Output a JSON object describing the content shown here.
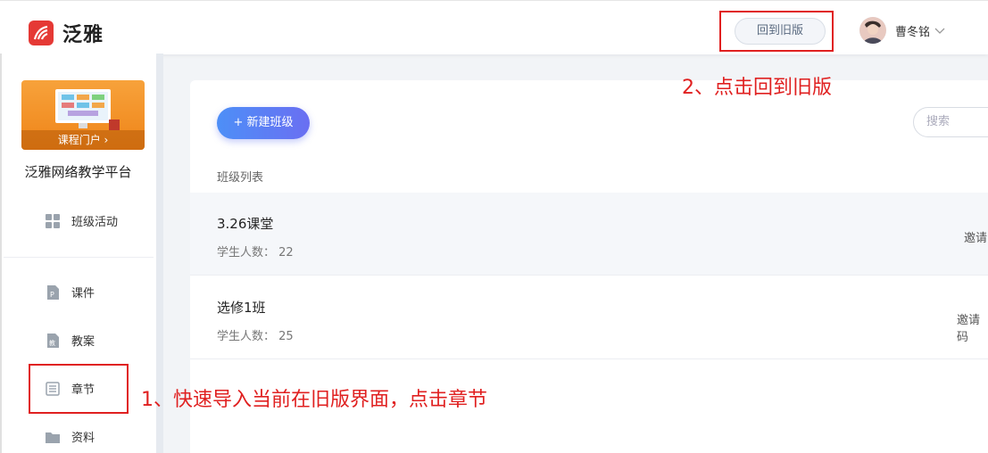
{
  "header": {
    "app_name": "泛雅",
    "old_version_button": "回到旧版",
    "user_name": "曹冬铭"
  },
  "sidebar": {
    "cover_caption": "课程门户 ›",
    "course_title": "泛雅网络教学平台",
    "items": [
      {
        "label": "班级活动",
        "icon": "grid-icon"
      },
      {
        "label": "课件",
        "icon": "ppt-file-icon"
      },
      {
        "label": "教案",
        "icon": "lesson-plan-icon"
      },
      {
        "label": "章节",
        "icon": "chapter-list-icon"
      },
      {
        "label": "资料",
        "icon": "folder-icon"
      }
    ]
  },
  "main": {
    "new_class_button": "+ 新建班级",
    "search_placeholder": "搜索",
    "list_label": "班级列表",
    "classes": [
      {
        "name": "3.26课堂",
        "students_label": "学生人数：",
        "students": "22",
        "invite": "邀请"
      },
      {
        "name": "选修1班",
        "students_label": "学生人数：",
        "students": "25",
        "invite": "邀请码"
      }
    ]
  },
  "annotations": {
    "step1": "1、快速导入当前在旧版界面，点击章节",
    "step2": "2、点击回到旧版"
  },
  "colors": {
    "annotation_red": "#e02020",
    "brand_red": "#e53935",
    "primary_gradient_start": "#4d8ff7",
    "primary_gradient_end": "#6a6ff2"
  }
}
